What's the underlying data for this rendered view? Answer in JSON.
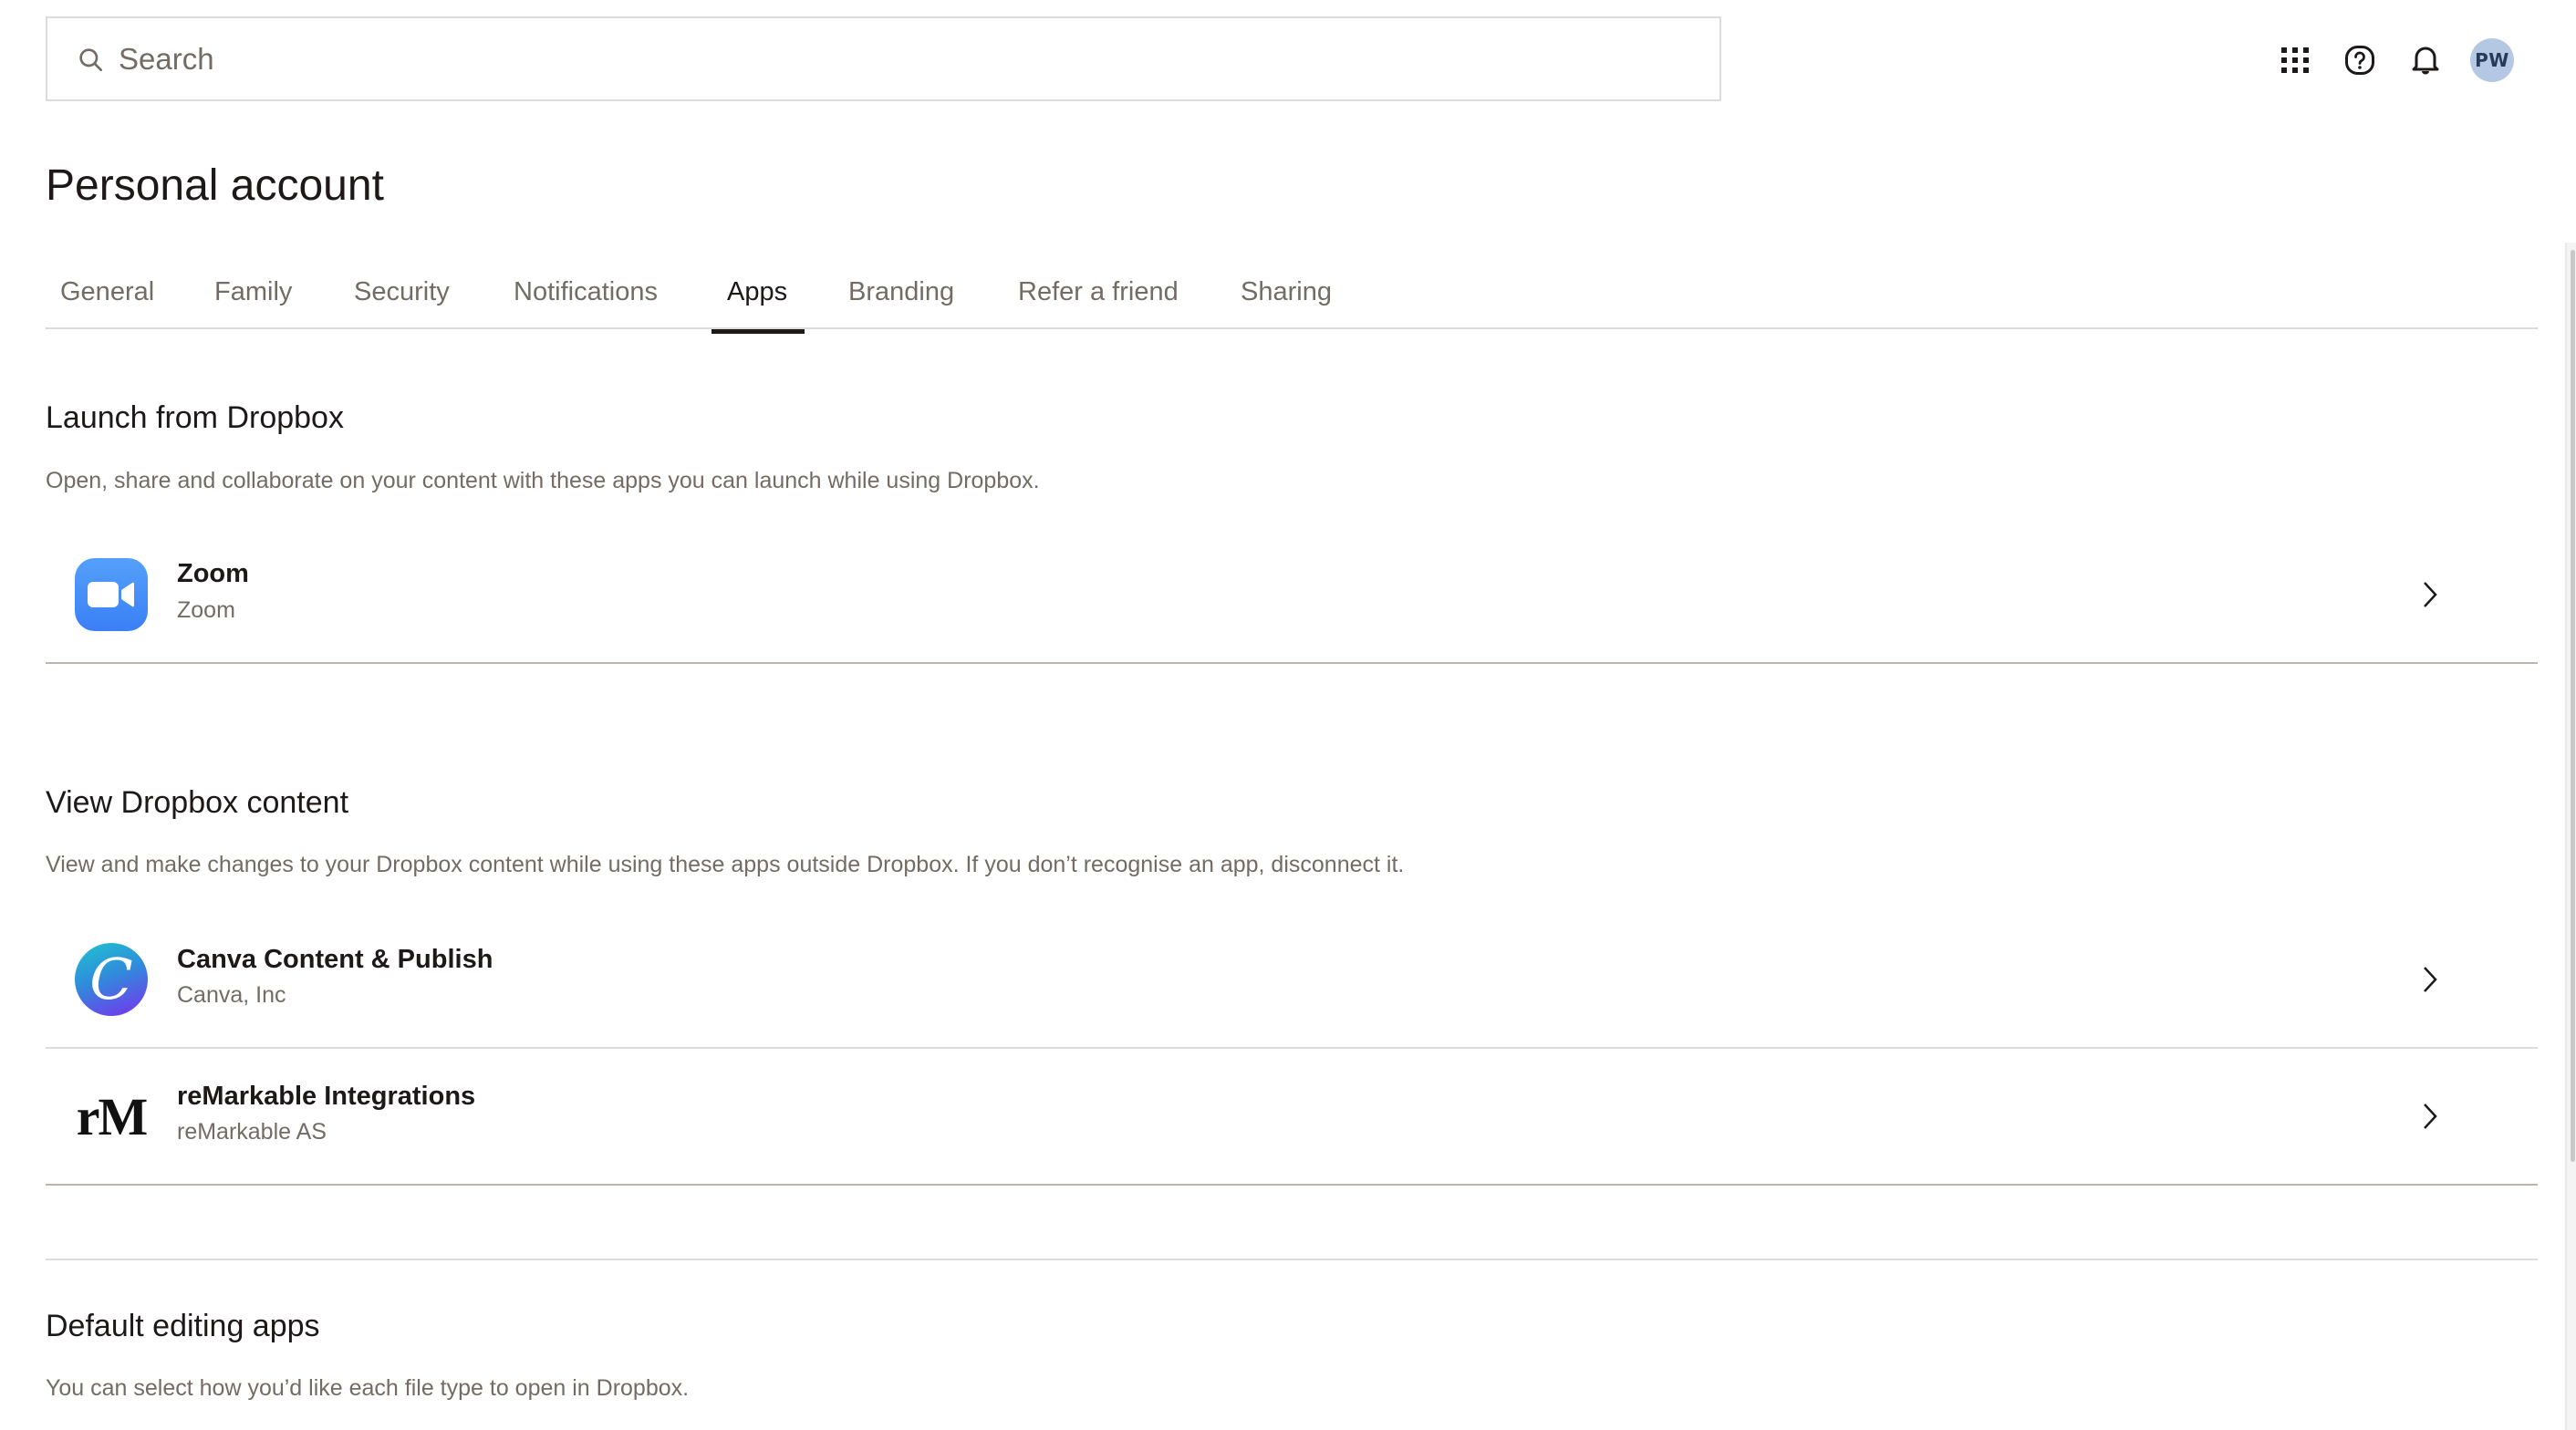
{
  "header": {
    "search": {
      "placeholder": "Search",
      "value": "",
      "icon": "search-icon"
    },
    "actions": [
      {
        "name": "apps-grid",
        "icon": "grid-icon"
      },
      {
        "name": "help",
        "icon": "help-icon"
      },
      {
        "name": "notifications",
        "icon": "bell-icon"
      }
    ],
    "avatar": {
      "initials": "PW",
      "bg_color": "#b4c8e3",
      "text_color": "#273a5a"
    }
  },
  "page": {
    "title": "Personal account",
    "tabs": [
      {
        "label": "General",
        "active": false
      },
      {
        "label": "Family",
        "active": false
      },
      {
        "label": "Security",
        "active": false
      },
      {
        "label": "Notifications",
        "active": false
      },
      {
        "label": "Apps",
        "active": true
      },
      {
        "label": "Branding",
        "active": false
      },
      {
        "label": "Refer a friend",
        "active": false
      },
      {
        "label": "Sharing",
        "active": false
      }
    ]
  },
  "sections": {
    "launch": {
      "title": "Launch from Dropbox",
      "description": "Open, share and collaborate on your content with these apps you can launch while using Dropbox.",
      "apps": [
        {
          "name": "Zoom",
          "vendor": "Zoom",
          "icon": "zoom-icon"
        }
      ]
    },
    "view": {
      "title": "View Dropbox content",
      "description": "View and make changes to your Dropbox content while using these apps outside Dropbox. If you don’t recognise an app, disconnect it.",
      "apps": [
        {
          "name": "Canva Content & Publish",
          "vendor": "Canva, Inc",
          "icon": "canva-icon",
          "glyph": "C"
        },
        {
          "name": "reMarkable Integrations",
          "vendor": "reMarkable AS",
          "icon": "remarkable-icon",
          "glyph": "rM"
        }
      ]
    },
    "default_editing": {
      "title": "Default editing apps",
      "description": "You can select how you’d like each file type to open in Dropbox."
    }
  },
  "colors": {
    "text_primary": "#1e1919",
    "text_secondary": "#736c64",
    "border": "#dcdcdc",
    "zoom_blue": "#3a7ff6"
  }
}
